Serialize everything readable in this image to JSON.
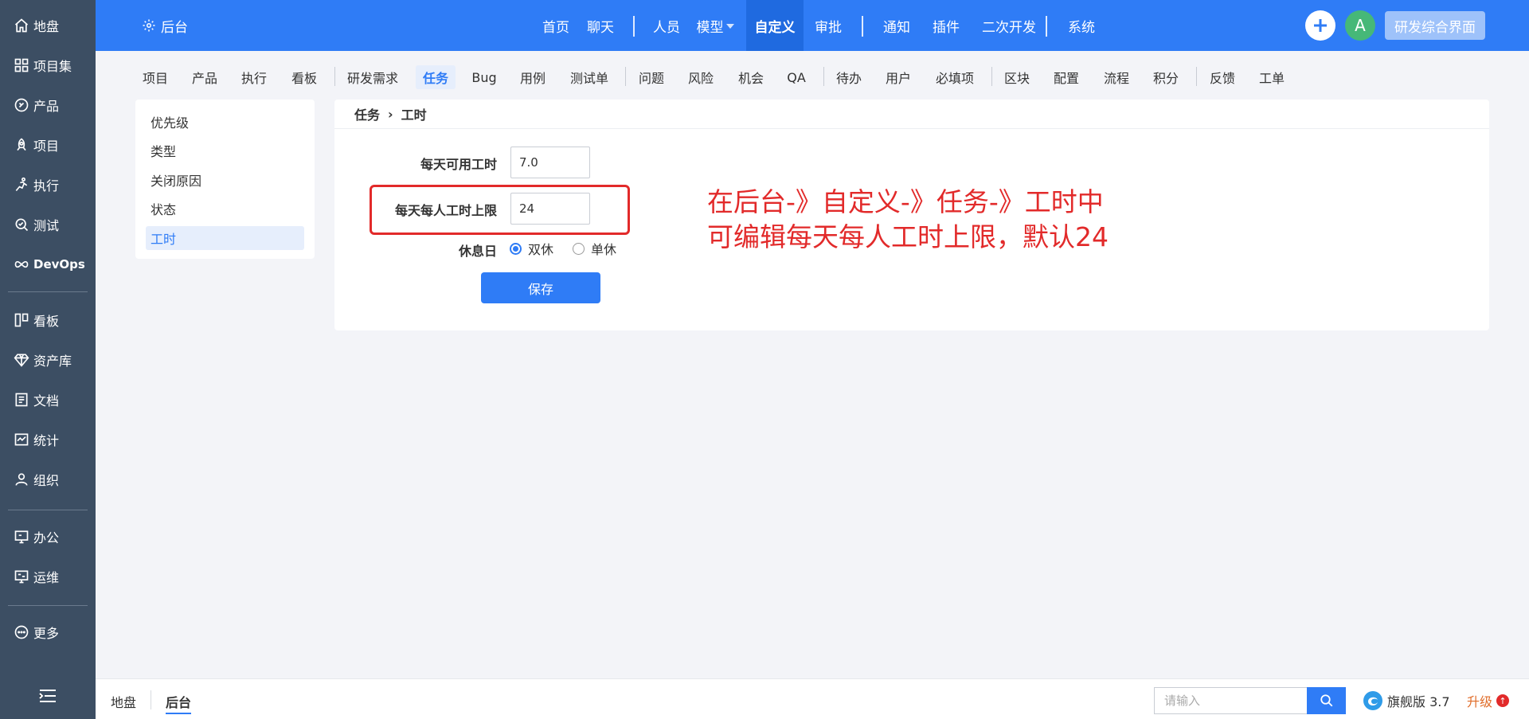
{
  "sidebar": {
    "items": [
      {
        "label": "地盘",
        "icon": "home-icon"
      },
      {
        "label": "项目集",
        "icon": "grid-icon"
      },
      {
        "label": "产品",
        "icon": "product-icon"
      },
      {
        "label": "项目",
        "icon": "project-icon"
      },
      {
        "label": "执行",
        "icon": "run-icon"
      },
      {
        "label": "测试",
        "icon": "test-icon"
      },
      {
        "label": "DevOps",
        "icon": "infinity-icon"
      },
      {
        "label": "看板",
        "icon": "kanban-icon"
      },
      {
        "label": "资产库",
        "icon": "diamond-icon"
      },
      {
        "label": "文档",
        "icon": "doc-icon"
      },
      {
        "label": "统计",
        "icon": "chart-icon"
      },
      {
        "label": "组织",
        "icon": "people-icon"
      },
      {
        "label": "办公",
        "icon": "office-icon"
      },
      {
        "label": "运维",
        "icon": "ops-icon"
      },
      {
        "label": "更多",
        "icon": "more-icon"
      }
    ]
  },
  "topbar": {
    "brand": "后台",
    "nav": [
      "首页",
      "聊天",
      "人员",
      "模型",
      "自定义",
      "审批",
      "通知",
      "插件",
      "二次开发",
      "系统"
    ],
    "active": "自定义",
    "avatar_letter": "A",
    "workspace_button": "研发综合界面"
  },
  "subnav": {
    "items": [
      "项目",
      "产品",
      "执行",
      "看板",
      "研发需求",
      "任务",
      "Bug",
      "用例",
      "测试单",
      "问题",
      "风险",
      "机会",
      "QA",
      "待办",
      "用户",
      "必填项",
      "区块",
      "配置",
      "流程",
      "积分",
      "反馈",
      "工单"
    ],
    "active": "任务"
  },
  "menu": {
    "items": [
      "优先级",
      "类型",
      "关闭原因",
      "状态",
      "工时"
    ],
    "active": "工时"
  },
  "breadcrumb": {
    "section": "任务",
    "page": "工时"
  },
  "form": {
    "daily_hours_label": "每天可用工时",
    "daily_hours_value": "7.0",
    "max_hours_label": "每天每人工时上限",
    "max_hours_value": "24",
    "rest_day_label": "休息日",
    "rest_options": [
      "双休",
      "单休"
    ],
    "rest_selected": "双休",
    "save_label": "保存"
  },
  "annotation": {
    "line1": "在后台-》自定义-》任务-》工时中",
    "line2": "可编辑每天每人工时上限，默认24",
    "color": "#e22a2a"
  },
  "bottombar": {
    "tabs": [
      "地盘",
      "后台"
    ],
    "active": "后台",
    "search_placeholder": "请输入",
    "edition": "旗舰版 3.7",
    "upgrade": "升级"
  },
  "colors": {
    "primary": "#2f7cf6",
    "sidebar": "#3c4e63"
  }
}
